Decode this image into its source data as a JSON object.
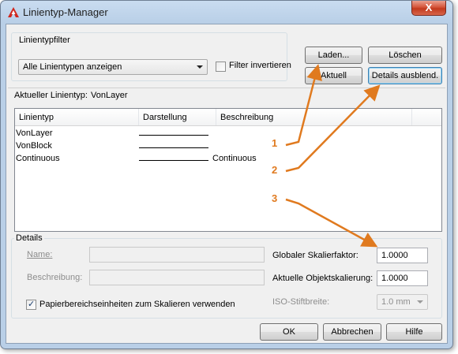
{
  "window": {
    "title": "Linientyp-Manager",
    "close_label": "X"
  },
  "filter": {
    "group_label": "Linientypfilter",
    "selected": "Alle Linientypen anzeigen",
    "invert_label": "Filter invertieren",
    "invert_checked": false
  },
  "toolbar": {
    "load_label": "Laden...",
    "delete_label": "Löschen",
    "current_label": "Aktuell",
    "details_toggle_label": "Details ausblend."
  },
  "current_linetype": {
    "label": "Aktueller Linientyp:",
    "value": "VonLayer"
  },
  "linetype_table": {
    "columns": [
      "Linientyp",
      "Darstellung",
      "Beschreibung"
    ],
    "rows": [
      {
        "name": "VonLayer",
        "description": ""
      },
      {
        "name": "VonBlock",
        "description": ""
      },
      {
        "name": "Continuous",
        "description": "Continuous"
      }
    ]
  },
  "details": {
    "group_label": "Details",
    "name_label": "Name:",
    "name_value": "",
    "description_label": "Beschreibung:",
    "description_value": "",
    "paper_space_label": "Papierbereichseinheiten zum Skalieren verwenden",
    "paper_space_checked": true,
    "global_scale_label": "Globaler Skalierfaktor:",
    "global_scale_value": "1.0000",
    "current_scale_label": "Aktuelle Objektskalierung:",
    "current_scale_value": "1.0000",
    "iso_pen_label": "ISO-Stiftbreite:",
    "iso_pen_value": "1.0 mm"
  },
  "footer": {
    "ok_label": "OK",
    "cancel_label": "Abbrechen",
    "help_label": "Hilfe"
  },
  "callouts": [
    "1",
    "2",
    "3"
  ],
  "colors": {
    "callout_accent": "#e07a1f",
    "title_bar": "#b9cfe7",
    "close_button": "#c9452a"
  },
  "icons": {
    "app": "autocad-logo-icon",
    "close": "close-icon",
    "combo_arrow": "chevron-down-icon"
  }
}
